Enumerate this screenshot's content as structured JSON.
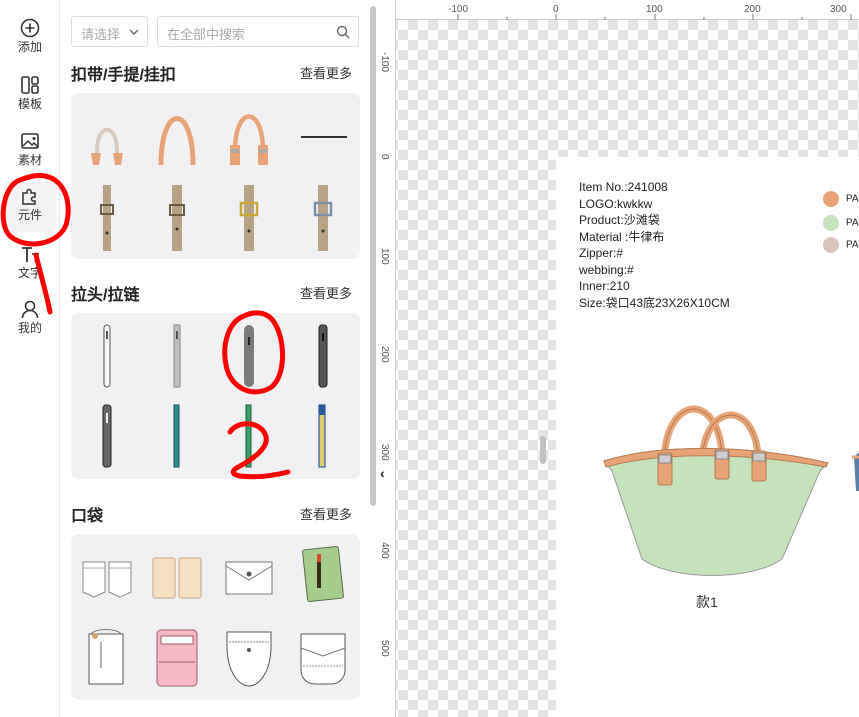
{
  "rail": {
    "items": [
      {
        "label": "添加",
        "icon": "plus-circle-icon"
      },
      {
        "label": "模板",
        "icon": "template-icon"
      },
      {
        "label": "素材",
        "icon": "image-icon"
      },
      {
        "label": "元件",
        "icon": "puzzle-icon"
      },
      {
        "label": "文字",
        "icon": "text-icon"
      },
      {
        "label": "我的",
        "icon": "user-icon"
      }
    ]
  },
  "panel": {
    "select_placeholder": "请选择",
    "search_placeholder": "在全部中搜索",
    "sections": [
      {
        "title": "扣带/手提/挂扣",
        "more": "查看更多"
      },
      {
        "title": "拉头/拉链",
        "more": "查看更多"
      },
      {
        "title": "口袋",
        "more": "查看更多"
      }
    ]
  },
  "canvas": {
    "ruler_top": [
      "-100",
      "0",
      "100",
      "200",
      "300"
    ],
    "ruler_left": [
      "-100",
      "0",
      "100",
      "200",
      "300",
      "400",
      "500"
    ],
    "info": [
      "Item No.:241008",
      "LOGO:kwkkw",
      "Product:沙滩袋",
      "Material :牛律布",
      "Zipper:#",
      "webbing:#",
      "Inner:210",
      "Size:袋口43底23X26X10CM"
    ],
    "legend": [
      {
        "label": "PA",
        "color": "#e8a477"
      },
      {
        "label": "PA",
        "color": "#c6e3bd"
      },
      {
        "label": "PA",
        "color": "#d9c3bd"
      }
    ],
    "style_label": "款1",
    "collapse_glyph": "‹"
  },
  "annotations": {
    "color": "#ff0000",
    "numbers": [
      "1",
      "2"
    ]
  }
}
